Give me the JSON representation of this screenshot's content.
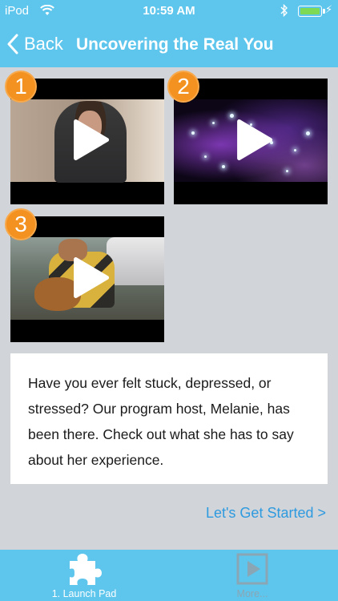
{
  "status_bar": {
    "carrier": "iPod",
    "time": "10:59 AM"
  },
  "nav": {
    "back_label": "Back",
    "title": "Uncovering the Real You"
  },
  "videos": [
    {
      "number": "1",
      "scene": "person-speaking"
    },
    {
      "number": "2",
      "scene": "purple-sparkles"
    },
    {
      "number": "3",
      "scene": "guitar-player"
    }
  ],
  "description": "Have you ever felt stuck, depressed, or stressed? Our program host, Melanie, has been there. Check out what she has to say about her experience.",
  "cta_label": "Let's Get Started >",
  "tabs": [
    {
      "label": "1. Launch Pad",
      "icon": "puzzle-piece-icon",
      "active": true
    },
    {
      "label": "More...",
      "icon": "play-square-icon",
      "active": false
    }
  ],
  "colors": {
    "accent": "#5ec5ec",
    "badge": "#f39220",
    "link": "#2e9adf",
    "background": "#d1d4d9"
  }
}
